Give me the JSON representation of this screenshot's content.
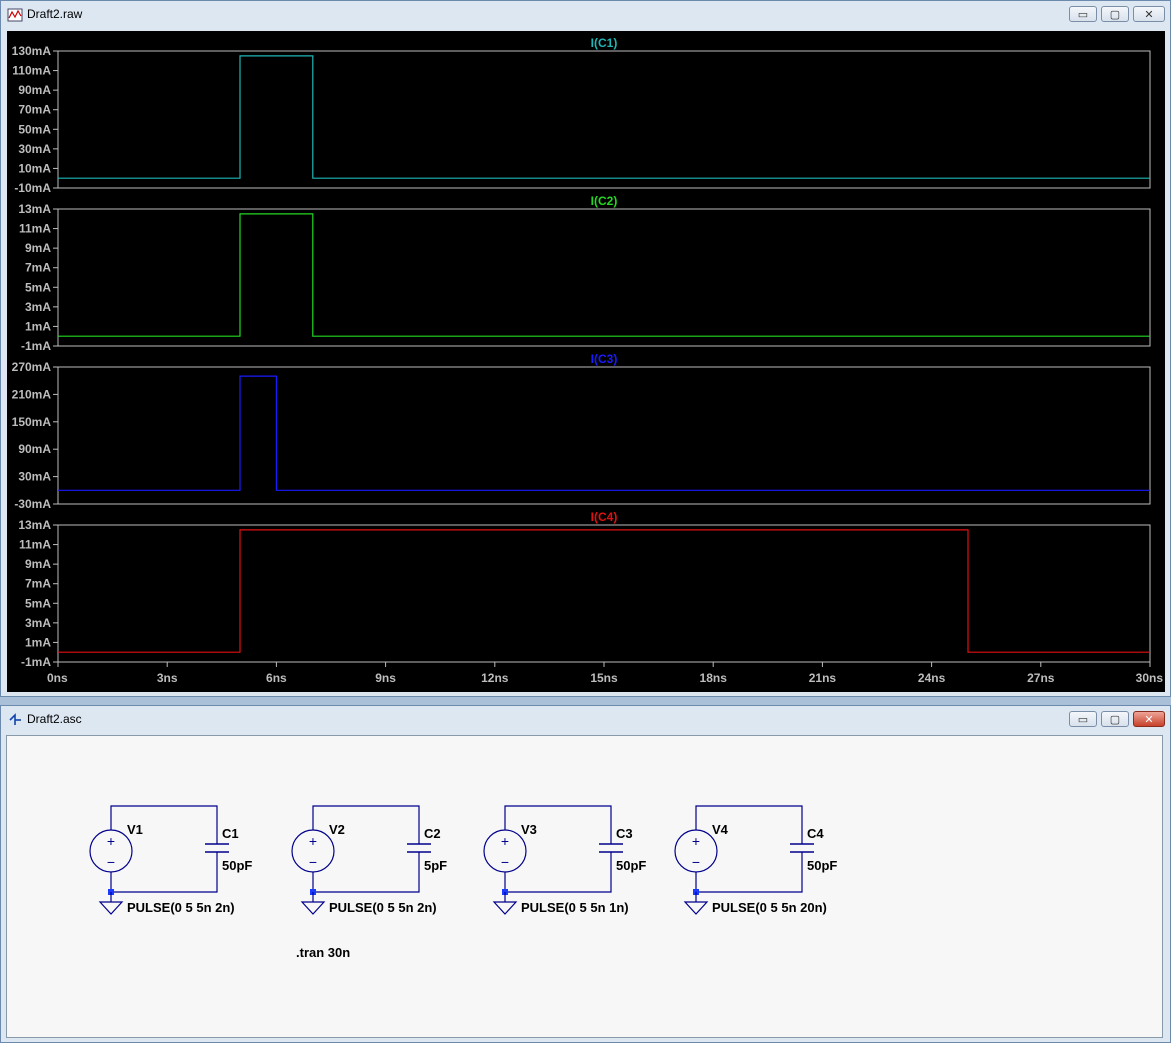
{
  "waveform_window": {
    "title": "Draft2.raw",
    "buttons": {
      "minimize": "▭",
      "maximize": "▢",
      "close": "✕"
    }
  },
  "schematic_window": {
    "title": "Draft2.asc",
    "buttons": {
      "minimize": "▭",
      "maximize": "▢",
      "close": "✕"
    }
  },
  "colors": {
    "c1": "#1fb6b6",
    "c2": "#22d822",
    "c3": "#1a1aff",
    "c4": "#e01010",
    "wire": "#00008b",
    "plot_bg": "#000000",
    "axis": "#bdbdbd"
  },
  "chart_data": {
    "type": "line",
    "xlabel": "",
    "xlim": [
      0,
      30
    ],
    "x_ticks": [
      "0ns",
      "3ns",
      "6ns",
      "9ns",
      "12ns",
      "15ns",
      "18ns",
      "21ns",
      "24ns",
      "27ns",
      "30ns"
    ],
    "panes": [
      {
        "name": "I(C1)",
        "color": "#1fb6b6",
        "ylim": [
          -10,
          130
        ],
        "y_ticks": [
          "130mA",
          "110mA",
          "90mA",
          "70mA",
          "50mA",
          "30mA",
          "10mA",
          "-10mA"
        ],
        "x": [
          0,
          5,
          5,
          7,
          7,
          30
        ],
        "y": [
          0,
          0,
          125,
          125,
          0,
          0
        ]
      },
      {
        "name": "I(C2)",
        "color": "#22d822",
        "ylim": [
          -1,
          13
        ],
        "y_ticks": [
          "13mA",
          "11mA",
          "9mA",
          "7mA",
          "5mA",
          "3mA",
          "1mA",
          "-1mA"
        ],
        "x": [
          0,
          5,
          5,
          7,
          7,
          30
        ],
        "y": [
          0,
          0,
          12.5,
          12.5,
          0,
          0
        ]
      },
      {
        "name": "I(C3)",
        "color": "#1a1aff",
        "ylim": [
          -30,
          270
        ],
        "y_ticks": [
          "270mA",
          "210mA",
          "150mA",
          "90mA",
          "30mA",
          "-30mA"
        ],
        "x": [
          0,
          5,
          5,
          6,
          6,
          30
        ],
        "y": [
          0,
          0,
          250,
          250,
          0,
          0
        ]
      },
      {
        "name": "I(C4)",
        "color": "#e01010",
        "ylim": [
          -1,
          13
        ],
        "y_ticks": [
          "13mA",
          "11mA",
          "9mA",
          "7mA",
          "5mA",
          "3mA",
          "1mA",
          "-1mA"
        ],
        "x": [
          0,
          5,
          5,
          25,
          25,
          30
        ],
        "y": [
          0,
          0,
          12.5,
          12.5,
          0,
          0
        ]
      }
    ]
  },
  "schematic": {
    "circuits": [
      {
        "source": "V1",
        "cap": "C1",
        "cap_value": "50pF",
        "pulse": "PULSE(0 5 5n 2n)"
      },
      {
        "source": "V2",
        "cap": "C2",
        "cap_value": "5pF",
        "pulse": "PULSE(0 5 5n 2n)"
      },
      {
        "source": "V3",
        "cap": "C3",
        "cap_value": "50pF",
        "pulse": "PULSE(0 5 5n 1n)"
      },
      {
        "source": "V4",
        "cap": "C4",
        "cap_value": "50pF",
        "pulse": "PULSE(0 5 5n 20n)"
      }
    ],
    "directive": ".tran 30n"
  }
}
